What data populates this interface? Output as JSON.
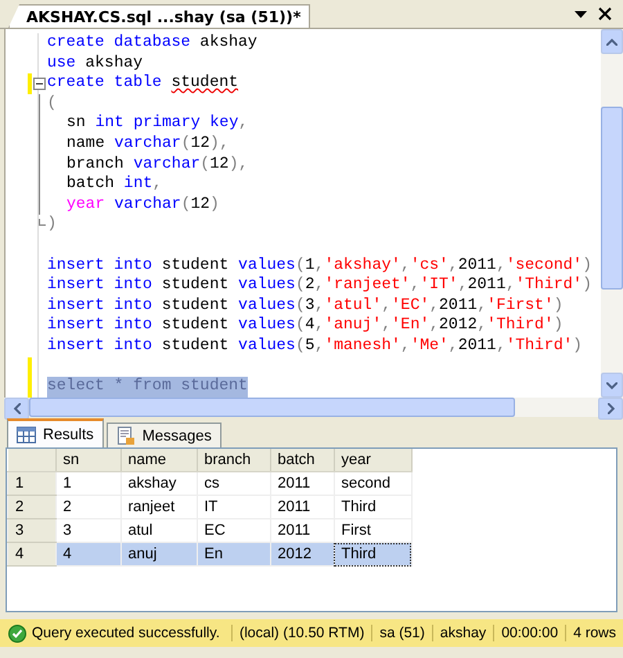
{
  "document_tab": {
    "title": "AKSHAY.CS.sql ...shay (sa (51))*",
    "selected": true
  },
  "editor": {
    "lines": [
      {
        "kind": "plain",
        "indented": false,
        "modified": false,
        "selected": false,
        "tokens": [
          {
            "text": "create database ",
            "kind": "keyword"
          },
          {
            "text": "akshay",
            "kind": "ident"
          }
        ]
      },
      {
        "kind": "plain",
        "indented": false,
        "modified": false,
        "selected": false,
        "tokens": [
          {
            "text": "use ",
            "kind": "keyword"
          },
          {
            "text": "akshay",
            "kind": "ident"
          }
        ]
      },
      {
        "kind": "fold",
        "indented": false,
        "modified": true,
        "selected": false,
        "tokens": [
          {
            "text": "create table ",
            "kind": "keyword"
          },
          {
            "text": "student",
            "kind": "unresolved"
          }
        ]
      },
      {
        "kind": "plain",
        "indented": false,
        "modified": false,
        "selected": false,
        "tokens": [
          {
            "text": "(",
            "kind": "punct"
          }
        ]
      },
      {
        "kind": "plain",
        "indented": true,
        "modified": false,
        "selected": false,
        "tokens": [
          {
            "text": "sn ",
            "kind": "ident"
          },
          {
            "text": "int primary key",
            "kind": "keyword"
          },
          {
            "text": ",",
            "kind": "punct"
          }
        ]
      },
      {
        "kind": "plain",
        "indented": true,
        "modified": false,
        "selected": false,
        "tokens": [
          {
            "text": "name ",
            "kind": "ident"
          },
          {
            "text": "varchar",
            "kind": "keyword"
          },
          {
            "text": "(",
            "kind": "punct"
          },
          {
            "text": "12",
            "kind": "ident"
          },
          {
            "text": "),",
            "kind": "punct"
          }
        ]
      },
      {
        "kind": "plain",
        "indented": true,
        "modified": false,
        "selected": false,
        "tokens": [
          {
            "text": "branch ",
            "kind": "ident"
          },
          {
            "text": "varchar",
            "kind": "keyword"
          },
          {
            "text": "(",
            "kind": "punct"
          },
          {
            "text": "12",
            "kind": "ident"
          },
          {
            "text": "),",
            "kind": "punct"
          }
        ]
      },
      {
        "kind": "plain",
        "indented": true,
        "modified": false,
        "selected": false,
        "tokens": [
          {
            "text": "batch ",
            "kind": "ident"
          },
          {
            "text": "int",
            "kind": "keyword"
          },
          {
            "text": ",",
            "kind": "punct"
          }
        ]
      },
      {
        "kind": "plain",
        "indented": true,
        "modified": false,
        "selected": false,
        "tokens": [
          {
            "text": "year ",
            "kind": "function"
          },
          {
            "text": "varchar",
            "kind": "keyword"
          },
          {
            "text": "(",
            "kind": "punct"
          },
          {
            "text": "12",
            "kind": "ident"
          },
          {
            "text": ")",
            "kind": "punct"
          }
        ]
      },
      {
        "kind": "fold-end",
        "indented": false,
        "modified": false,
        "selected": false,
        "tokens": [
          {
            "text": ")",
            "kind": "punct"
          }
        ]
      },
      {
        "kind": "blank",
        "modified": false,
        "selected": false
      },
      {
        "kind": "plain",
        "indented": false,
        "modified": false,
        "selected": false,
        "tokens": [
          {
            "text": "insert into ",
            "kind": "keyword"
          },
          {
            "text": "student ",
            "kind": "ident"
          },
          {
            "text": "values",
            "kind": "keyword"
          },
          {
            "text": "(",
            "kind": "punct"
          },
          {
            "text": "1",
            "kind": "ident"
          },
          {
            "text": ",",
            "kind": "punct"
          },
          {
            "text": "'akshay'",
            "kind": "string"
          },
          {
            "text": ",",
            "kind": "punct"
          },
          {
            "text": "'cs'",
            "kind": "string"
          },
          {
            "text": ",",
            "kind": "punct"
          },
          {
            "text": "2011",
            "kind": "ident"
          },
          {
            "text": ",",
            "kind": "punct"
          },
          {
            "text": "'second'",
            "kind": "string"
          },
          {
            "text": ")",
            "kind": "punct"
          }
        ]
      },
      {
        "kind": "plain",
        "indented": false,
        "modified": false,
        "selected": false,
        "tokens": [
          {
            "text": "insert into ",
            "kind": "keyword"
          },
          {
            "text": "student ",
            "kind": "ident"
          },
          {
            "text": "values",
            "kind": "keyword"
          },
          {
            "text": "(",
            "kind": "punct"
          },
          {
            "text": "2",
            "kind": "ident"
          },
          {
            "text": ",",
            "kind": "punct"
          },
          {
            "text": "'ranjeet'",
            "kind": "string"
          },
          {
            "text": ",",
            "kind": "punct"
          },
          {
            "text": "'IT'",
            "kind": "string"
          },
          {
            "text": ",",
            "kind": "punct"
          },
          {
            "text": "2011",
            "kind": "ident"
          },
          {
            "text": ",",
            "kind": "punct"
          },
          {
            "text": "'Third'",
            "kind": "string"
          },
          {
            "text": ")",
            "kind": "punct"
          }
        ]
      },
      {
        "kind": "plain",
        "indented": false,
        "modified": false,
        "selected": false,
        "tokens": [
          {
            "text": "insert into ",
            "kind": "keyword"
          },
          {
            "text": "student ",
            "kind": "ident"
          },
          {
            "text": "values",
            "kind": "keyword"
          },
          {
            "text": "(",
            "kind": "punct"
          },
          {
            "text": "3",
            "kind": "ident"
          },
          {
            "text": ",",
            "kind": "punct"
          },
          {
            "text": "'atul'",
            "kind": "string"
          },
          {
            "text": ",",
            "kind": "punct"
          },
          {
            "text": "'EC'",
            "kind": "string"
          },
          {
            "text": ",",
            "kind": "punct"
          },
          {
            "text": "2011",
            "kind": "ident"
          },
          {
            "text": ",",
            "kind": "punct"
          },
          {
            "text": "'First'",
            "kind": "string"
          },
          {
            "text": ")",
            "kind": "punct"
          }
        ]
      },
      {
        "kind": "plain",
        "indented": false,
        "modified": false,
        "selected": false,
        "tokens": [
          {
            "text": "insert into ",
            "kind": "keyword"
          },
          {
            "text": "student ",
            "kind": "ident"
          },
          {
            "text": "values",
            "kind": "keyword"
          },
          {
            "text": "(",
            "kind": "punct"
          },
          {
            "text": "4",
            "kind": "ident"
          },
          {
            "text": ",",
            "kind": "punct"
          },
          {
            "text": "'anuj'",
            "kind": "string"
          },
          {
            "text": ",",
            "kind": "punct"
          },
          {
            "text": "'En'",
            "kind": "string"
          },
          {
            "text": ",",
            "kind": "punct"
          },
          {
            "text": "2012",
            "kind": "ident"
          },
          {
            "text": ",",
            "kind": "punct"
          },
          {
            "text": "'Third'",
            "kind": "string"
          },
          {
            "text": ")",
            "kind": "punct"
          }
        ]
      },
      {
        "kind": "plain",
        "indented": false,
        "modified": false,
        "selected": false,
        "tokens": [
          {
            "text": "insert into ",
            "kind": "keyword"
          },
          {
            "text": "student ",
            "kind": "ident"
          },
          {
            "text": "values",
            "kind": "keyword"
          },
          {
            "text": "(",
            "kind": "punct"
          },
          {
            "text": "5",
            "kind": "ident"
          },
          {
            "text": ",",
            "kind": "punct"
          },
          {
            "text": "'manesh'",
            "kind": "string"
          },
          {
            "text": ",",
            "kind": "punct"
          },
          {
            "text": "'Me'",
            "kind": "string"
          },
          {
            "text": ",",
            "kind": "punct"
          },
          {
            "text": "2011",
            "kind": "ident"
          },
          {
            "text": ",",
            "kind": "punct"
          },
          {
            "text": "'Third'",
            "kind": "string"
          },
          {
            "text": ")",
            "kind": "punct"
          }
        ]
      },
      {
        "kind": "blank",
        "modified": true,
        "selected": false
      },
      {
        "kind": "plain",
        "indented": false,
        "modified": true,
        "selected": true,
        "tokens": [
          {
            "text": "select * from student",
            "kind": "keyword"
          }
        ]
      }
    ]
  },
  "result_tabs": [
    {
      "label": "Results",
      "selected": true
    },
    {
      "label": "Messages",
      "selected": false
    }
  ],
  "grid": {
    "columns": [
      "sn",
      "name",
      "branch",
      "batch",
      "year"
    ],
    "rows": [
      {
        "number": "1",
        "selected": false,
        "cells": [
          "1",
          "akshay",
          "cs",
          "2011",
          "second"
        ]
      },
      {
        "number": "2",
        "selected": false,
        "cells": [
          "2",
          "ranjeet",
          "IT",
          "2011",
          "Third"
        ]
      },
      {
        "number": "3",
        "selected": false,
        "cells": [
          "3",
          "atul",
          "EC",
          "2011",
          "First"
        ]
      },
      {
        "number": "4",
        "selected": true,
        "cells": [
          "4",
          "anuj",
          "En",
          "2012",
          "Third"
        ]
      }
    ]
  },
  "status_bar": {
    "message": "Query executed successfully.",
    "segments": [
      "(local) (10.50 RTM)",
      "sa (51)",
      "akshay",
      "00:00:00",
      "4 rows"
    ]
  }
}
